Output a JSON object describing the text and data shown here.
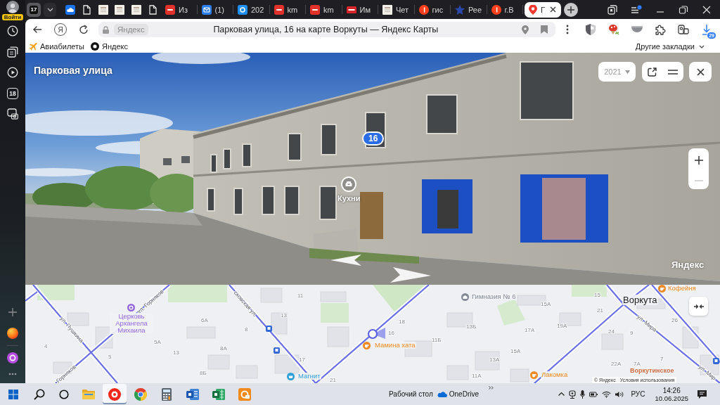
{
  "sidebar": {
    "login_label": "Войти",
    "tile_label": "18"
  },
  "tab_strip": {
    "tab_count": "17",
    "tabs": [
      {
        "selected": false
      },
      {
        "selected": false
      },
      {
        "selected": false
      },
      {
        "selected": false
      },
      {
        "selected": false
      },
      {
        "selected": false
      },
      {
        "label": "Из",
        "selected": false
      },
      {
        "label": "(1)",
        "selected": false
      },
      {
        "label": "202",
        "selected": false
      },
      {
        "label": "km",
        "selected": false
      },
      {
        "label": "km",
        "selected": false
      },
      {
        "label": "Им",
        "selected": false
      },
      {
        "label": "Чет",
        "selected": false
      },
      {
        "label": "гис",
        "selected": false
      },
      {
        "label": "Рее",
        "selected": false
      },
      {
        "label": "г.В",
        "selected": false
      },
      {
        "label": "Г",
        "selected": true
      }
    ]
  },
  "toolbar": {
    "home_logo": "Я",
    "site_chip": "Яндекс",
    "page_title": "Парковая улица, 16 на карте Воркуты — Яндекс Карты",
    "downloads_badge": "29"
  },
  "bookmarks_bar": {
    "items": [
      "Авиабилеты",
      "Яндекс"
    ],
    "other_bookmarks": "Другие закладки"
  },
  "panorama": {
    "street_name": "Парковая улица",
    "year": "2021",
    "house_marker": "16",
    "place_label": "Кухни",
    "logo": "Яндекс",
    "zoom_buttons": [
      {
        "kind": "plus",
        "disabled": false
      },
      {
        "kind": "minus",
        "disabled": true
      }
    ]
  },
  "map": {
    "city": "Воркута",
    "pois": [
      {
        "kind": "church",
        "label": "Церковь Архангела Михаила",
        "color": "#9466dc"
      },
      {
        "kind": "school",
        "label": "Гимназия № 6",
        "color": "#858a94"
      },
      {
        "kind": "cafe",
        "label": "Мамина хата",
        "color": "#f08a24"
      },
      {
        "kind": "shop",
        "label": "Магнит",
        "color": "#2f9fd8"
      },
      {
        "kind": "cafe",
        "label": "Лакомка",
        "color": "#f08a24"
      },
      {
        "kind": "cafe",
        "label": "Кофейня",
        "color": "#f08a24"
      },
      {
        "kind": "text",
        "label": "Воркутинское",
        "color": "#d0704a"
      }
    ],
    "streets": [
      "ул. Горняков",
      "сковская ул.",
      "ул. Пушкина",
      "Горняков",
      "ул. Мира",
      "ул. Мир"
    ],
    "house_numbers": [
      "11",
      "13",
      "6А",
      "8",
      "8А",
      "5А",
      "13",
      "4",
      "5",
      "17",
      "21",
      "8Б",
      "18",
      "16",
      "11Б",
      "13Б",
      "15А",
      "17А",
      "19А",
      "15А",
      "13А",
      "11А",
      "15",
      "21",
      "24",
      "9",
      "26",
      "7",
      "22А",
      "7А"
    ],
    "attribution": "© Яндекс",
    "terms_link": "Условия использования"
  },
  "taskbar": {
    "apps": [
      {
        "selected": false
      },
      {
        "selected": true
      },
      {
        "selected": false
      },
      {
        "selected": false
      },
      {
        "selected": false
      },
      {
        "selected": false
      },
      {
        "selected": false
      }
    ],
    "desktop_label": "Рабочий стол",
    "onedrive_label": "OneDrive",
    "language": "РУС",
    "time": "14:26",
    "date": "10.06.2025"
  }
}
